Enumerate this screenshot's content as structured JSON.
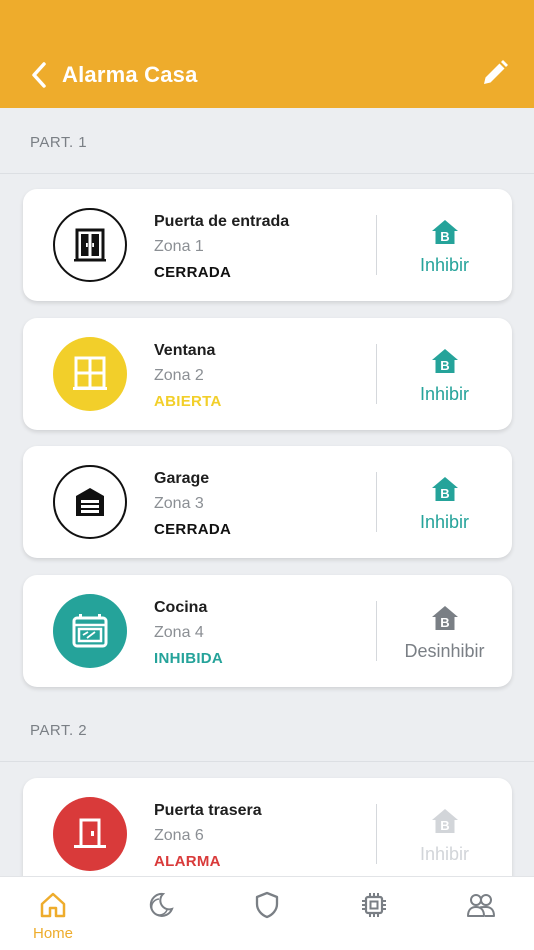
{
  "header": {
    "title": "Alarma Casa"
  },
  "sections": [
    {
      "label": "PART. 1"
    },
    {
      "label": "PART. 2"
    }
  ],
  "zones": [
    {
      "name": "Puerta de entrada",
      "zone": "Zona 1",
      "status": "CERRADA",
      "status_color": "#111111",
      "icon": "door-icon",
      "action": "Inhibir",
      "action_color": "#25a39a"
    },
    {
      "name": "Ventana",
      "zone": "Zona 2",
      "status": "ABIERTA",
      "status_color": "#f2cf2a",
      "icon": "window-icon",
      "action": "Inhibir",
      "action_color": "#25a39a"
    },
    {
      "name": "Garage",
      "zone": "Zona 3",
      "status": "CERRADA",
      "status_color": "#111111",
      "icon": "garage-icon",
      "action": "Inhibir",
      "action_color": "#25a39a"
    },
    {
      "name": "Cocina",
      "zone": "Zona 4",
      "status": "INHIBIDA",
      "status_color": "#25a39a",
      "icon": "oven-icon",
      "action": "Desinhibir",
      "action_color": "#7a7f85"
    },
    {
      "name": "Puerta trasera",
      "zone": "Zona 6",
      "status": "ALARMA",
      "status_color": "#d93a3a",
      "icon": "back-door-icon",
      "action": "Inhibir",
      "action_color": "#d2d5d9"
    }
  ],
  "nav": {
    "home_label": "Home",
    "accent": "#eeac2c"
  },
  "colors": {
    "header_bg": "#eeac2c",
    "teal": "#25a39a",
    "yellow": "#f2cf2a",
    "red": "#d93a3a"
  }
}
